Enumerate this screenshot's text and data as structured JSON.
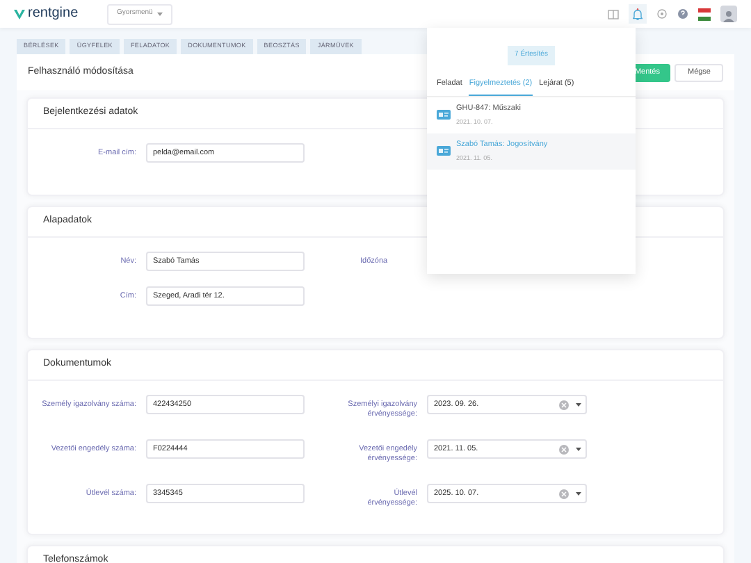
{
  "header": {
    "logo": "rentgine",
    "quick_menu": "Gyorsmenü"
  },
  "nav_tabs": [
    {
      "label": "BÉRLÉSEK",
      "selected": false
    },
    {
      "label": "ÜGYFELEK",
      "selected": false
    },
    {
      "label": "FELADATOK",
      "selected": false
    },
    {
      "label": "DOKUMENTUMOK",
      "selected": false
    },
    {
      "label": "BEOSZTÁS",
      "selected": false
    },
    {
      "label": "JÁRMŰVEK",
      "selected": false
    }
  ],
  "page": {
    "title": "Felhasználó módosítása",
    "buttons": [
      {
        "label": "Mentés",
        "kind": "primary"
      },
      {
        "label": "Mégse",
        "kind": "secondary"
      }
    ]
  },
  "login_section": {
    "title": "Bejelentkezési adatok",
    "fields": [
      {
        "label": "E-mail cím:",
        "value": "pelda@email.com"
      }
    ]
  },
  "basic_section": {
    "title": "Alapadatok",
    "fields": [
      {
        "label": "Név:",
        "value": "Szabó Tamás"
      },
      {
        "label": "Cím:",
        "value": "Szeged, Aradi tér 12."
      }
    ],
    "timezone_label": "Időzóna"
  },
  "documents_section": {
    "title": "Dokumentumok",
    "rows": [
      {
        "label": "Személy igazolvány száma:",
        "value": "422434250",
        "expiry_label": "Személyi igazolvány érvényessége:",
        "expiry": "2023. 09. 26."
      },
      {
        "label": "Vezetői engedély száma:",
        "value": "F0224444",
        "expiry_label": "Vezetői engedély érvényessége:",
        "expiry": "2021. 11. 05."
      },
      {
        "label": "Útlevél száma:",
        "value": "3345345",
        "expiry_label": "Útlevél érvényessége:",
        "expiry": "2025. 10. 07."
      }
    ]
  },
  "phones_section": {
    "title": "Telefonszámok"
  },
  "notifications": {
    "count_label": "7 Értesítés",
    "tabs": [
      {
        "label": "Feladat",
        "selected": false
      },
      {
        "label": "Figyelmeztetés (2)",
        "selected": true
      },
      {
        "label": "Lejárat (5)",
        "selected": false
      }
    ],
    "items": [
      {
        "title": "GHU-847: Műszaki",
        "date": "2021. 10. 07.",
        "selected": false
      },
      {
        "title": "Szabó Tamás: Jogosítvány",
        "date": "2021. 11. 05.",
        "selected": true
      }
    ]
  }
}
